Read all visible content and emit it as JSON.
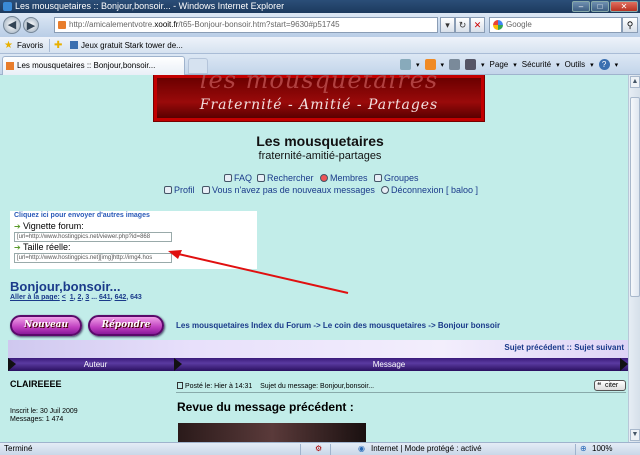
{
  "window": {
    "title": "Les mousquetaires :: Bonjour,bonsoir... - Windows Internet Explorer",
    "minimize": "–",
    "maximize": "□",
    "close": "✕"
  },
  "address": {
    "url_prefix": "http://amicalementvotre.",
    "url_host": "xooit.fr",
    "url_rest": "/t65-Bonjour-bonsoir.htm?start=9630#p51745",
    "search_placeholder": "Google"
  },
  "favorites": {
    "label": "Favoris",
    "link": "Jeux gratuit Stark tower de..."
  },
  "tab": {
    "label": "Les mousquetaires :: Bonjour,bonsoir..."
  },
  "commands": {
    "page": "Page",
    "security": "Sécurité",
    "tools": "Outils",
    "help": "?"
  },
  "banner": {
    "title": "les mousquetaires",
    "subtitle": "Fraternité  -  Amitié  -  Partages"
  },
  "site": {
    "title": "Les mousquetaires",
    "description": "fraternité-amitié-partages"
  },
  "nav": {
    "faq": "FAQ",
    "search": "Rechercher",
    "members": "Membres",
    "groups": "Groupes",
    "profile": "Profil",
    "messages": "Vous n'avez pas de nouveaux messages",
    "logout": "Déconnexion [ baloo ]"
  },
  "imagebox": {
    "caption": "Cliquez ici pour envoyer d'autres images",
    "thumb_label": "Vignette forum:",
    "thumb_value": "[url=http://www.hostingpics.net/viewer.php?id=868",
    "full_label": "Taille réelle:",
    "full_value": "[url=http://www.hostingpics.net][img]http://img4.hos"
  },
  "topic": {
    "title": "Bonjour,bonsoir...",
    "pager_label": "Aller à la page:",
    "pager_prev": "<",
    "pager_p1": "1",
    "pager_p2": "2",
    "pager_p3": "3",
    "pager_dots": "...",
    "pager_p641": "641",
    "pager_p642": "642",
    "pager_current": "643"
  },
  "buttons": {
    "new": "Nouveau",
    "reply": "Répondre"
  },
  "breadcrumb": "Les mousquetaires Index du Forum -> Le coin des mousquetaires -> Bonjour bonsoir",
  "topicnav": {
    "previous": "Sujet précédent",
    "separator": "::",
    "next": "Sujet suivant"
  },
  "header": {
    "author": "Auteur",
    "message": "Message"
  },
  "post": {
    "author": "CLAIREEEE",
    "posted": "Posté le: Hier à 14:31",
    "subject": "Sujet du message: Bonjour,bonsoir...",
    "quote": "citer",
    "review_title": "Revue du message précédent :",
    "joined": "Inscrit le: 30 Juil 2009",
    "messages": "Messages: 1 474"
  },
  "status": {
    "left": "Terminé",
    "zone": "Internet | Mode protégé : activé",
    "zoom": "100%"
  },
  "colors": {
    "page_bg": "#c2ede9",
    "link": "#1a3a8a",
    "banner": "#9a0a0a",
    "header_bar": "#3a1a7a",
    "arrow": "#e01010",
    "button": "#c040c0"
  },
  "icons": [
    "ie-icon",
    "back-icon",
    "forward-icon",
    "refresh-icon",
    "stop-icon",
    "google-icon",
    "star-icon",
    "home-icon",
    "rss-icon",
    "print-icon",
    "arrow-icon"
  ]
}
